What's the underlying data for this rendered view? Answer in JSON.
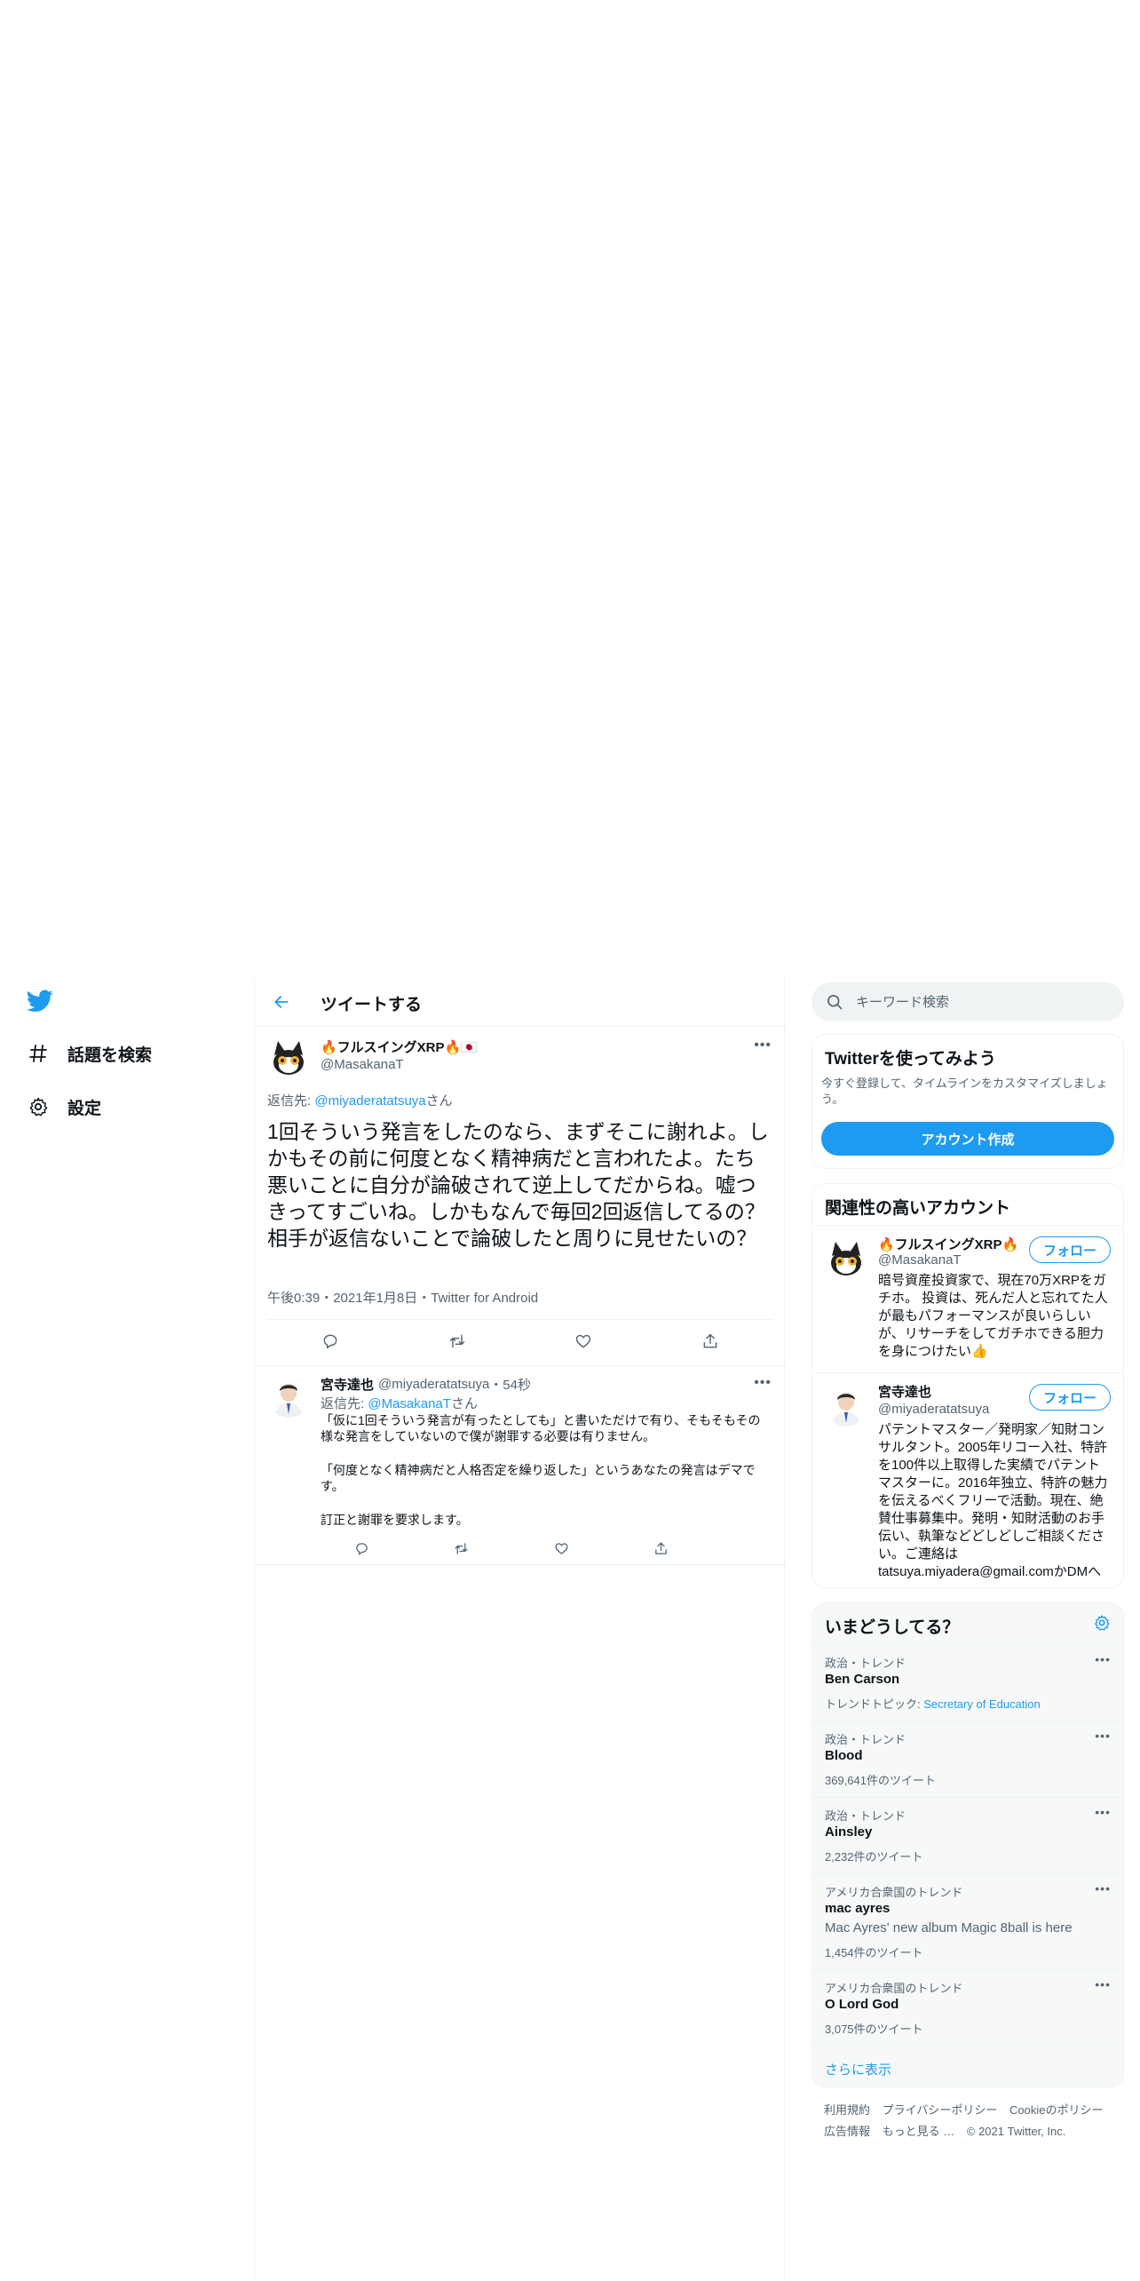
{
  "nav": {
    "items": [
      {
        "label": "話題を検索",
        "icon": "hashtag-icon"
      },
      {
        "label": "設定",
        "icon": "gear-icon"
      }
    ]
  },
  "header": {
    "title": "ツイートする"
  },
  "main_tweet": {
    "name": "🔥フルスイングXRP🔥🇯🇵",
    "handle": "@MasakanaT",
    "reply_prefix": "返信先: ",
    "reply_handle": "@miyaderatatsuya",
    "reply_suffix": "さん",
    "text": "1回そういう発言をしたのなら、まずそこに謝れよ。しかもその前に何度となく精神病だと言われたよ。たち悪いことに自分が論破されて逆上してだからね。嘘つきってすごいね。しかもなんで毎回2回返信してるの？相手が返信ないことで論破したと周りに見せたいの？",
    "meta": "午後0:39・2021年1月8日・Twitter for Android"
  },
  "reply_tweet": {
    "name": "宮寺達也",
    "handle": "@miyaderatatsuya",
    "time": "・54秒",
    "reply_prefix": "返信先: ",
    "reply_handle": "@MasakanaT",
    "reply_suffix": "さん",
    "p1": "「仮に1回そういう発言が有ったとしても」と書いただけで有り、そもそもその様な発言をしていないので僕が謝罪する必要は有りません。",
    "p2": "「何度となく精神病だと人格否定を繰り返した」というあなたの発言はデマです。",
    "p3": "訂正と謝罪を要求します。"
  },
  "search": {
    "placeholder": "キーワード検索"
  },
  "signup": {
    "title": "Twitterを使ってみよう",
    "subtitle": "今すぐ登録して、タイムラインをカスタマイズしましょう。",
    "button": "アカウント作成"
  },
  "related": {
    "title": "関連性の高いアカウント",
    "follow_label": "フォロー",
    "accounts": [
      {
        "name": "🔥フルスイングXRP🔥",
        "handle": "@MasakanaT",
        "bio": "暗号資産投資家で、現在70万XRPをガチホ。 投資は、死んだ人と忘れてた人が最もパフォーマンスが良いらしいが、リサーチをしてガチホできる胆力を身につけたい👍"
      },
      {
        "name": "宮寺達也",
        "handle": "@miyaderatatsuya",
        "bio": "パテントマスター／発明家／知財コンサルタント。2005年リコー入社、特許を100件以上取得した実績でパテントマスターに。2016年独立、特許の魅力を伝えるべくフリーで活動。現在、絶賛仕事募集中。発明・知財活動のお手伝い、執筆などどしどしご相談ください。ご連絡は tatsuya.miyadera@gmail.comかDMへ"
      }
    ]
  },
  "trends": {
    "title": "いまどうしてる？",
    "items": [
      {
        "context": "政治・トレンド",
        "title": "Ben Carson",
        "sub_prefix": "トレンドトピック: ",
        "sub_link": "Secretary of Education",
        "count": ""
      },
      {
        "context": "政治・トレンド",
        "title": "Blood",
        "sub_prefix": "",
        "sub_link": "",
        "count": "369,641件のツイート"
      },
      {
        "context": "政治・トレンド",
        "title": "Ainsley",
        "sub_prefix": "",
        "sub_link": "",
        "count": "2,232件のツイート"
      },
      {
        "context": "アメリカ合衆国のトレンド",
        "title": "mac ayres",
        "sub_prefix": "Mac Ayres' new album Magic 8ball is here",
        "sub_link": "",
        "count": "1,454件のツイート"
      },
      {
        "context": "アメリカ合衆国のトレンド",
        "title": "O Lord God",
        "sub_prefix": "",
        "sub_link": "",
        "count": "3,075件のツイート"
      }
    ],
    "show_more": "さらに表示"
  },
  "footer": {
    "links": [
      "利用規約",
      "プライバシーポリシー",
      "Cookieのポリシー",
      "広告情報",
      "もっと見る …"
    ],
    "copyright": "© 2021 Twitter, Inc."
  },
  "colors": {
    "accent": "#1d9bf0",
    "text": "#0f1419",
    "secondary": "#536471"
  }
}
